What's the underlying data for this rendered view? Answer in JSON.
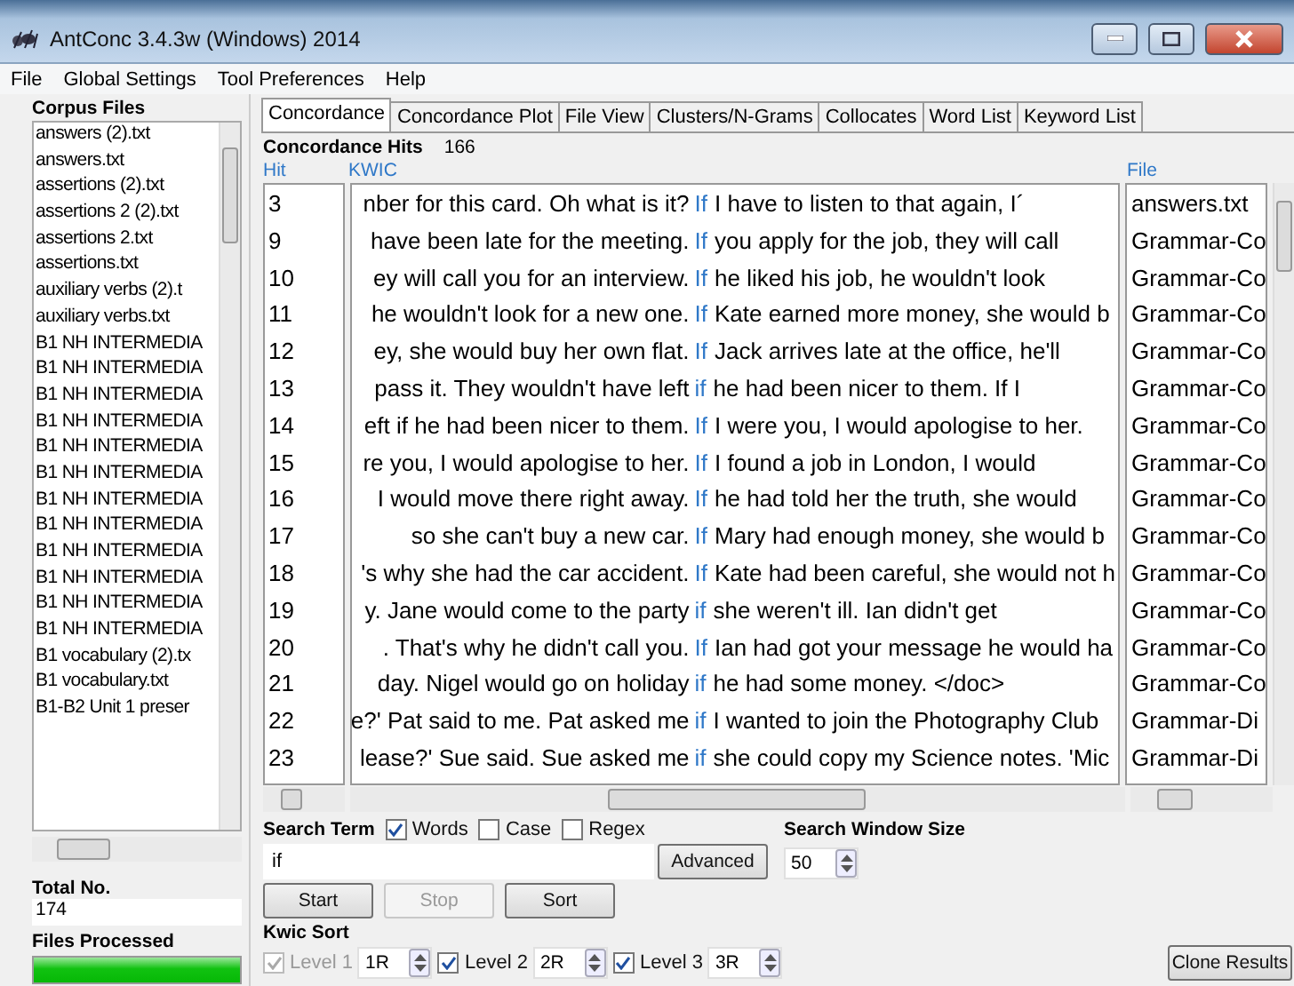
{
  "window": {
    "title": "AntConc 3.4.3w (Windows) 2014"
  },
  "menu": [
    "File",
    "Global Settings",
    "Tool Preferences",
    "Help"
  ],
  "corpus_files": {
    "title": "Corpus Files",
    "items": [
      "answers (2).txt",
      "answers.txt",
      "assertions (2).txt",
      "assertions 2 (2).txt",
      "assertions 2.txt",
      "assertions.txt",
      "auxiliary verbs (2).t",
      "auxiliary verbs.txt",
      "B1 NH INTERMEDIA",
      "B1 NH INTERMEDIA",
      "B1 NH INTERMEDIA",
      "B1 NH INTERMEDIA",
      "B1 NH INTERMEDIA",
      "B1 NH INTERMEDIA",
      "B1 NH INTERMEDIA",
      "B1 NH INTERMEDIA",
      "B1 NH INTERMEDIA",
      "B1 NH INTERMEDIA",
      "B1 NH INTERMEDIA",
      "B1 NH INTERMEDIA",
      "B1 vocabulary (2).tx",
      "B1 vocabulary.txt",
      "B1-B2 Unit 1 preser"
    ]
  },
  "total": {
    "label": "Total No.",
    "value": "174"
  },
  "files_processed": {
    "label": "Files Processed",
    "level": 1
  },
  "tabs": [
    {
      "label": "Concordance",
      "selected": true
    },
    {
      "label": "Concordance Plot",
      "selected": false
    },
    {
      "label": "File View",
      "selected": false
    },
    {
      "label": "Clusters/N-Grams",
      "selected": false
    },
    {
      "label": "Collocates",
      "selected": false
    },
    {
      "label": "Word List",
      "selected": false
    },
    {
      "label": "Keyword List",
      "selected": false
    }
  ],
  "hits": {
    "label": "Concordance Hits",
    "value": "166"
  },
  "table": {
    "columns": [
      "Hit",
      "KWIC",
      "File"
    ],
    "rows": [
      {
        "hit": "3",
        "left": "nber for this card. Oh what is it?",
        "keyword": "If",
        "right": "I have to listen to that again, I´",
        "file": "answers.txt"
      },
      {
        "hit": "9",
        "left": "have been late for the meeting.",
        "keyword": "If",
        "right": "you apply for the job, they will call",
        "file": "Grammar-Co"
      },
      {
        "hit": "10",
        "left": "ey will call you for an interview.",
        "keyword": "If",
        "right": "he liked his job, he wouldn't look",
        "file": "Grammar-Co"
      },
      {
        "hit": "11",
        "left": "he wouldn't look for a new one.",
        "keyword": "If",
        "right": "Kate earned more money, she would b",
        "file": "Grammar-Co"
      },
      {
        "hit": "12",
        "left": "ey, she would buy her own flat.",
        "keyword": "If",
        "right": "Jack arrives late at the office, he'll",
        "file": "Grammar-Co"
      },
      {
        "hit": "13",
        "left": "pass it. They wouldn't have left",
        "keyword": "if",
        "right": "he had been nicer to them. If I",
        "file": "Grammar-Co"
      },
      {
        "hit": "14",
        "left": "eft if he had been nicer to them.",
        "keyword": "If",
        "right": "I were you, I would apologise to her.",
        "file": "Grammar-Co"
      },
      {
        "hit": "15",
        "left": "re you, I would apologise to her.",
        "keyword": "If",
        "right": "I found a job in London, I would",
        "file": "Grammar-Co"
      },
      {
        "hit": "16",
        "left": "I would move there right away.",
        "keyword": "If",
        "right": "he had told her the truth, she would",
        "file": "Grammar-Co"
      },
      {
        "hit": "17",
        "left": "so she can't buy a new car.",
        "keyword": "If",
        "right": "Mary had enough money, she would b",
        "file": "Grammar-Co"
      },
      {
        "hit": "18",
        "left": "'s why she had the car accident.",
        "keyword": "If",
        "right": "Kate had been careful, she would not h",
        "file": "Grammar-Co"
      },
      {
        "hit": "19",
        "left": "y. Jane would come to the party",
        "keyword": "if",
        "right": "she weren't ill. Ian didn't get",
        "file": "Grammar-Co"
      },
      {
        "hit": "20",
        "left": ". That's why he didn't call you.",
        "keyword": "If",
        "right": "Ian had got your message he would ha",
        "file": "Grammar-Co"
      },
      {
        "hit": "21",
        "left": "day. Nigel would go on holiday",
        "keyword": "if",
        "right": "he had some money. </doc>",
        "file": "Grammar-Co"
      },
      {
        "hit": "22",
        "left": "e?' Pat said to me. Pat asked me",
        "keyword": "if",
        "right": "I wanted to join the Photography Club",
        "file": "Grammar-Di"
      },
      {
        "hit": "23",
        "left": "lease?' Sue said. Sue asked me",
        "keyword": "if",
        "right": "she could copy my Science notes. 'Mic",
        "file": "Grammar-Di"
      }
    ]
  },
  "search": {
    "label": "Search Term",
    "options": [
      {
        "label": "Words",
        "checked": true
      },
      {
        "label": "Case",
        "checked": false
      },
      {
        "label": "Regex",
        "checked": false
      }
    ],
    "value": "if",
    "advanced": "Advanced"
  },
  "window_size": {
    "label": "Search Window Size",
    "value": "50"
  },
  "buttons": [
    {
      "label": "Start",
      "disabled": false
    },
    {
      "label": "Stop",
      "disabled": true
    },
    {
      "label": "Sort",
      "disabled": false
    }
  ],
  "kwic_sort": {
    "label": "Kwic Sort",
    "levels": [
      {
        "label": "Level 1",
        "checked": true,
        "disabled": true,
        "value": "1R"
      },
      {
        "label": "Level 2",
        "checked": true,
        "disabled": false,
        "value": "2R"
      },
      {
        "label": "Level 3",
        "checked": true,
        "disabled": false,
        "value": "3R"
      }
    ]
  },
  "clone": "Clone Results"
}
